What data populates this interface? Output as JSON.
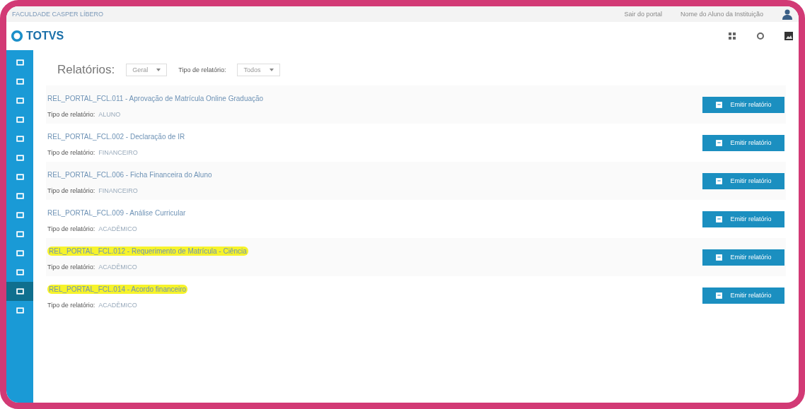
{
  "top_bar": {
    "breadcrumb": "FACULDADE CASPER LÍBERO",
    "links": [
      "Sair do portal",
      "Nome do Aluno da Instituição"
    ]
  },
  "logo": {
    "text": "TOTVS"
  },
  "sidebar": {
    "items": [
      {
        "selected": false
      },
      {
        "selected": false
      },
      {
        "selected": false
      },
      {
        "selected": false
      },
      {
        "selected": false
      },
      {
        "selected": false
      },
      {
        "selected": false
      },
      {
        "selected": false
      },
      {
        "selected": false
      },
      {
        "selected": false
      },
      {
        "selected": false
      },
      {
        "selected": false
      },
      {
        "selected": true
      },
      {
        "selected": false
      }
    ]
  },
  "filters": {
    "title": "Relatórios:",
    "first_select": "Geral",
    "type_label": "Tipo de relatório:",
    "type_select": "Todos"
  },
  "reports": [
    {
      "name": "REL_PORTAL_FCL.011 - Aprovação de Matrícula Online Graduação",
      "type_label": "Tipo de relatório:",
      "type": "ALUNO",
      "highlighted": false,
      "button": "Emitir relatório"
    },
    {
      "name": "REL_PORTAL_FCL.002 - Declaração de IR",
      "type_label": "Tipo de relatório:",
      "type": "FINANCEIRO",
      "highlighted": false,
      "button": "Emitir relatório"
    },
    {
      "name": "REL_PORTAL_FCL.006 - Ficha Financeira do Aluno",
      "type_label": "Tipo de relatório:",
      "type": "FINANCEIRO",
      "highlighted": false,
      "button": "Emitir relatório"
    },
    {
      "name": "REL_PORTAL_FCL.009 - Análise Curricular",
      "type_label": "Tipo de relatório:",
      "type": "ACADÊMICO",
      "highlighted": false,
      "button": "Emitir relatório"
    },
    {
      "name": "REL_PORTAL_FCL.012 - Requerimento de Matrícula - Ciência",
      "type_label": "Tipo de relatório:",
      "type": "ACADÊMICO",
      "highlighted": true,
      "button": "Emitir relatório"
    },
    {
      "name": "REL_PORTAL_FCL.014 - Acordo financeiro",
      "type_label": "Tipo de relatório:",
      "type": "ACADÊMICO",
      "highlighted": true,
      "button": "Emitir relatório"
    }
  ]
}
